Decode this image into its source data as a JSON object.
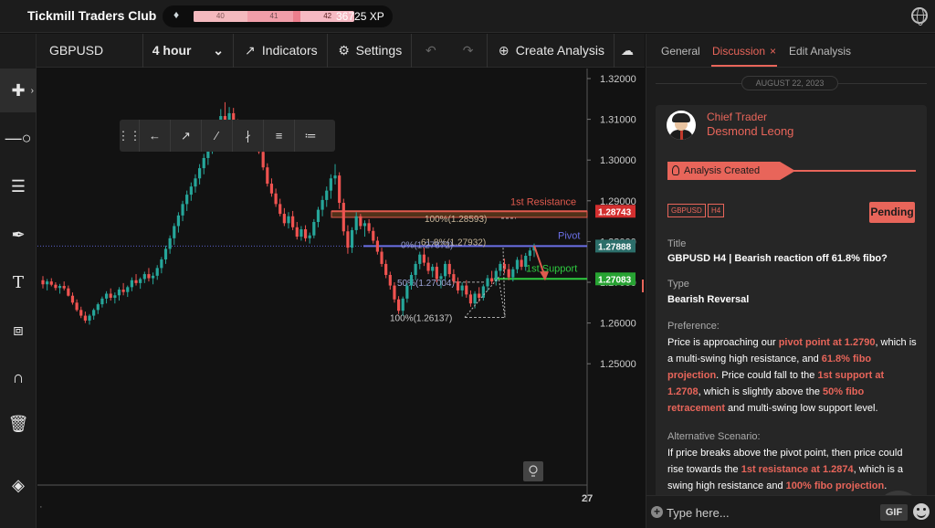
{
  "header": {
    "title": "Tickmill Traders Club",
    "level_segments": [
      "40",
      "41",
      "42"
    ],
    "level_progress": 0.62,
    "xp": "36725 XP"
  },
  "toolbar": {
    "symbol": "GBPUSD",
    "interval": "4 hour",
    "indicators": "Indicators",
    "settings": "Settings",
    "create_analysis": "Create Analysis"
  },
  "chart": {
    "price_ticks": [
      "1.32000",
      "1.31000",
      "1.30000",
      "1.29000",
      "1.28000",
      "1.27000",
      "1.26000",
      "1.25000"
    ],
    "date_tick": "27",
    "labels": {
      "resistance": "1st Resistance",
      "pivot": "Pivot",
      "support": "1st Support",
      "fib_100_top": "100%(1.28593)",
      "fib_618": "61.8%(1.27932)",
      "fib_0": "0%(1.27872)",
      "fib_50": "50%(1.27004)",
      "fib_100_bottom": "100%(1.26137)"
    },
    "price_tags": {
      "resistance": "1.28743",
      "pivot": "1.27888",
      "support": "1.27083"
    },
    "colors": {
      "resistance": "#e05a4e",
      "pivot": "#6b6fe6",
      "support": "#2ecc40",
      "up": "#26a69a",
      "down": "#ef5350"
    },
    "candles": [
      [
        1.2705,
        1.2715,
        1.2685,
        1.2695
      ],
      [
        1.2695,
        1.2708,
        1.268,
        1.2702
      ],
      [
        1.2702,
        1.271,
        1.269,
        1.2694
      ],
      [
        1.2694,
        1.27,
        1.268,
        1.2686
      ],
      [
        1.2686,
        1.2696,
        1.2672,
        1.2691
      ],
      [
        1.2691,
        1.2702,
        1.268,
        1.2685
      ],
      [
        1.2685,
        1.2692,
        1.2665,
        1.2667
      ],
      [
        1.2667,
        1.2675,
        1.2645,
        1.265
      ],
      [
        1.265,
        1.2658,
        1.2628,
        1.2632
      ],
      [
        1.2632,
        1.264,
        1.2612,
        1.2618
      ],
      [
        1.2618,
        1.2628,
        1.26,
        1.2606
      ],
      [
        1.2606,
        1.2622,
        1.2596,
        1.2618
      ],
      [
        1.2618,
        1.2636,
        1.2608,
        1.2632
      ],
      [
        1.2632,
        1.265,
        1.2622,
        1.2646
      ],
      [
        1.2646,
        1.2665,
        1.2638,
        1.266
      ],
      [
        1.266,
        1.2678,
        1.2648,
        1.2672
      ],
      [
        1.2672,
        1.2685,
        1.2655,
        1.2662
      ],
      [
        1.2662,
        1.2675,
        1.2648,
        1.2668
      ],
      [
        1.2668,
        1.2688,
        1.2655,
        1.2682
      ],
      [
        1.2682,
        1.2698,
        1.2668,
        1.2676
      ],
      [
        1.2676,
        1.2692,
        1.2664,
        1.2688
      ],
      [
        1.2688,
        1.2712,
        1.2678,
        1.2705
      ],
      [
        1.2705,
        1.272,
        1.2692,
        1.2698
      ],
      [
        1.2698,
        1.2712,
        1.2684,
        1.2708
      ],
      [
        1.2708,
        1.2726,
        1.2698,
        1.272
      ],
      [
        1.272,
        1.2735,
        1.2702,
        1.271
      ],
      [
        1.271,
        1.2724,
        1.2695,
        1.2716
      ],
      [
        1.2716,
        1.2742,
        1.2706,
        1.2735
      ],
      [
        1.2735,
        1.2762,
        1.2722,
        1.2756
      ],
      [
        1.2756,
        1.279,
        1.2745,
        1.2782
      ],
      [
        1.2782,
        1.2815,
        1.277,
        1.2808
      ],
      [
        1.2808,
        1.2845,
        1.2792,
        1.2838
      ],
      [
        1.2838,
        1.2872,
        1.2822,
        1.2864
      ],
      [
        1.2864,
        1.29,
        1.285,
        1.2892
      ],
      [
        1.2892,
        1.2925,
        1.2875,
        1.2915
      ],
      [
        1.2915,
        1.2945,
        1.29,
        1.2935
      ],
      [
        1.2935,
        1.2965,
        1.292,
        1.2955
      ],
      [
        1.2955,
        1.299,
        1.294,
        1.298
      ],
      [
        1.298,
        1.3015,
        1.2965,
        1.3005
      ],
      [
        1.3005,
        1.304,
        1.2988,
        1.303
      ],
      [
        1.303,
        1.3068,
        1.3015,
        1.3058
      ],
      [
        1.3058,
        1.3098,
        1.3042,
        1.3088
      ],
      [
        1.3088,
        1.3125,
        1.3072,
        1.3108
      ],
      [
        1.3108,
        1.3142,
        1.309,
        1.3098
      ],
      [
        1.3098,
        1.313,
        1.3078,
        1.3115
      ],
      [
        1.3115,
        1.3128,
        1.3085,
        1.3092
      ],
      [
        1.3092,
        1.31,
        1.3055,
        1.306
      ],
      [
        1.306,
        1.3082,
        1.3035,
        1.3072
      ],
      [
        1.3072,
        1.3085,
        1.3048,
        1.3056
      ],
      [
        1.3056,
        1.3075,
        1.304,
        1.3068
      ],
      [
        1.3068,
        1.308,
        1.3045,
        1.305
      ],
      [
        1.305,
        1.306,
        1.3015,
        1.302
      ],
      [
        1.302,
        1.303,
        1.2975,
        1.2982
      ],
      [
        1.2982,
        1.2992,
        1.2935,
        1.2942
      ],
      [
        1.2942,
        1.2955,
        1.291,
        1.2918
      ],
      [
        1.2918,
        1.293,
        1.2885,
        1.2892
      ],
      [
        1.2892,
        1.2905,
        1.2862,
        1.2868
      ],
      [
        1.2868,
        1.2882,
        1.2838,
        1.2845
      ],
      [
        1.2845,
        1.2872,
        1.2832,
        1.2862
      ],
      [
        1.2862,
        1.2875,
        1.2828,
        1.2835
      ],
      [
        1.2835,
        1.2848,
        1.2805,
        1.2812
      ],
      [
        1.2812,
        1.2838,
        1.2802,
        1.283
      ],
      [
        1.283,
        1.284,
        1.28,
        1.2808
      ],
      [
        1.2808,
        1.2822,
        1.2795,
        1.2815
      ],
      [
        1.2815,
        1.2855,
        1.2808,
        1.2848
      ],
      [
        1.2848,
        1.2885,
        1.2835,
        1.2878
      ],
      [
        1.2878,
        1.2912,
        1.2862,
        1.2902
      ],
      [
        1.2902,
        1.2935,
        1.2885,
        1.2925
      ],
      [
        1.2925,
        1.2965,
        1.2905,
        1.2955
      ],
      [
        1.2955,
        1.299,
        1.294,
        1.2962
      ],
      [
        1.2962,
        1.297,
        1.288,
        1.2895
      ],
      [
        1.2895,
        1.2905,
        1.2815,
        1.2825
      ],
      [
        1.2825,
        1.284,
        1.277,
        1.2785
      ],
      [
        1.2785,
        1.2835,
        1.2772,
        1.2828
      ],
      [
        1.2828,
        1.2872,
        1.2818,
        1.2862
      ],
      [
        1.2862,
        1.2868,
        1.283,
        1.2838
      ],
      [
        1.2838,
        1.2852,
        1.2812,
        1.2845
      ],
      [
        1.2845,
        1.2855,
        1.282,
        1.2826
      ],
      [
        1.2826,
        1.2835,
        1.2795,
        1.2802
      ],
      [
        1.2802,
        1.2812,
        1.2768,
        1.2775
      ],
      [
        1.2775,
        1.2785,
        1.2738,
        1.2745
      ],
      [
        1.2745,
        1.2755,
        1.271,
        1.2718
      ],
      [
        1.2718,
        1.2726,
        1.2682,
        1.2692
      ],
      [
        1.2692,
        1.27,
        1.265,
        1.2658
      ],
      [
        1.2658,
        1.2666,
        1.2622,
        1.263
      ],
      [
        1.263,
        1.2665,
        1.2618,
        1.266
      ],
      [
        1.266,
        1.2698,
        1.265,
        1.2692
      ],
      [
        1.2692,
        1.2725,
        1.2682,
        1.2718
      ],
      [
        1.2718,
        1.2752,
        1.2705,
        1.2745
      ],
      [
        1.2745,
        1.2775,
        1.2732,
        1.2768
      ],
      [
        1.2768,
        1.2785,
        1.274,
        1.2748
      ],
      [
        1.2748,
        1.2762,
        1.272,
        1.2728
      ],
      [
        1.2728,
        1.2745,
        1.2712,
        1.2738
      ],
      [
        1.2738,
        1.2748,
        1.27,
        1.2708
      ],
      [
        1.2708,
        1.2722,
        1.2685,
        1.2715
      ],
      [
        1.2715,
        1.2752,
        1.2705,
        1.2745
      ],
      [
        1.2745,
        1.2755,
        1.2712,
        1.272
      ],
      [
        1.272,
        1.2732,
        1.2695,
        1.2702
      ],
      [
        1.2702,
        1.2712,
        1.2672,
        1.268
      ],
      [
        1.268,
        1.27,
        1.2665,
        1.2692
      ],
      [
        1.2692,
        1.2705,
        1.2662,
        1.267
      ],
      [
        1.267,
        1.268,
        1.264,
        1.2648
      ],
      [
        1.2648,
        1.2678,
        1.2636,
        1.2672
      ],
      [
        1.2672,
        1.2688,
        1.2652,
        1.2662
      ],
      [
        1.2662,
        1.2695,
        1.2655,
        1.269
      ],
      [
        1.269,
        1.2718,
        1.2678,
        1.271
      ],
      [
        1.271,
        1.2728,
        1.2695,
        1.2702
      ],
      [
        1.2702,
        1.2735,
        1.2692,
        1.2728
      ],
      [
        1.2728,
        1.2752,
        1.2715,
        1.2745
      ],
      [
        1.2745,
        1.2758,
        1.2722,
        1.2732
      ],
      [
        1.2732,
        1.2745,
        1.2705,
        1.2712
      ],
      [
        1.2712,
        1.2738,
        1.2702,
        1.2732
      ],
      [
        1.2732,
        1.2762,
        1.2722,
        1.2755
      ],
      [
        1.2755,
        1.2768,
        1.273,
        1.2738
      ],
      [
        1.2738,
        1.2772,
        1.2728,
        1.2765
      ],
      [
        1.2765,
        1.2785,
        1.2752,
        1.2778
      ],
      [
        1.2778,
        1.2795,
        1.2762,
        1.2788
      ]
    ]
  },
  "panel": {
    "tabs": [
      "General",
      "Discussion",
      "Edit Analysis"
    ],
    "close_glyph": "×",
    "date": "AUGUST 22, 2023",
    "role": "Chief Trader",
    "author": "Desmond Leong",
    "banner": "Analysis Created",
    "tags": [
      "GBPUSD",
      "H4"
    ],
    "status": "Pending",
    "title_label": "Title",
    "title_value": "GBPUSD H4 | Bearish reaction off 61.8% fibo?",
    "type_label": "Type",
    "type_value": "Bearish Reversal",
    "preference_label": "Preference:",
    "preference": {
      "p1": "Price is approaching our ",
      "h1": "pivot point at 1.2790",
      "p2": ", which is a multi-swing high resistance, and ",
      "h2": "61.8% fibo projection",
      "p3": ". Price could fall to the ",
      "h3": "1st support at 1.2708",
      "p4": ", which is slightly above the ",
      "h4": "50% fibo retracement",
      "p5": " and multi-swing low support level."
    },
    "alt_label": "Alternative Scenario:",
    "alt": {
      "p1": "If price breaks above the pivot point, then price could rise towards the ",
      "h1": "1st resistance at 1.2874",
      "p2": ", which is a swing high resistance and ",
      "h2": "100% fibo projection",
      "p3": "."
    },
    "composer_placeholder": "Type here...",
    "gif_label": "GIF"
  }
}
